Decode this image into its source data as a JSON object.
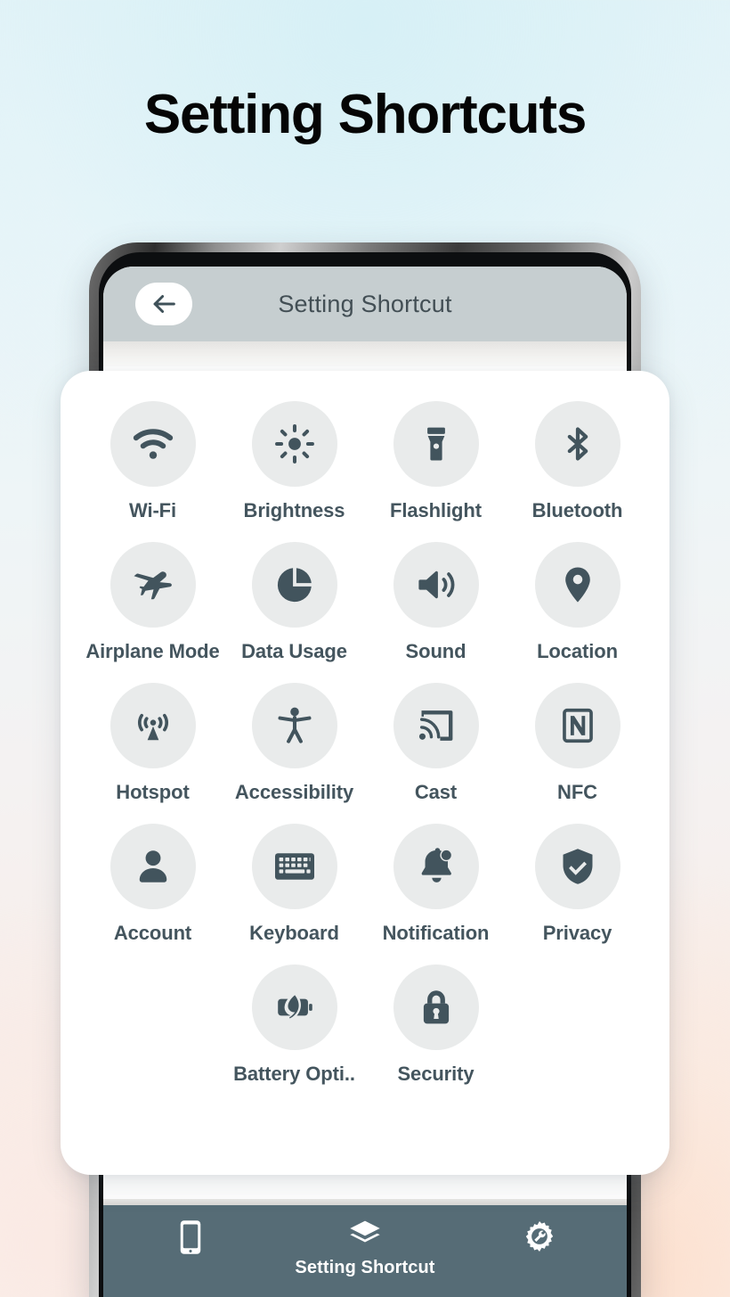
{
  "page": {
    "title": "Setting Shortcuts"
  },
  "colors": {
    "icon_dark": "#42545d",
    "tile_circle": "#e9ebeb",
    "header_bar": "#c6ced0",
    "bottom_nav": "#566c76",
    "label_text": "#44555e"
  },
  "app_header": {
    "back_icon": "arrow-left-icon",
    "title": "Setting Shortcut"
  },
  "shortcuts": [
    {
      "label": "Wi-Fi",
      "icon": "wifi-icon"
    },
    {
      "label": "Brightness",
      "icon": "brightness-sun-icon"
    },
    {
      "label": "Flashlight",
      "icon": "flashlight-icon"
    },
    {
      "label": "Bluetooth",
      "icon": "bluetooth-icon"
    },
    {
      "label": "Airplane Mode",
      "icon": "airplane-icon"
    },
    {
      "label": "Data Usage",
      "icon": "pie-chart-icon"
    },
    {
      "label": "Sound",
      "icon": "speaker-volume-icon"
    },
    {
      "label": "Location",
      "icon": "map-pin-icon"
    },
    {
      "label": "Hotspot",
      "icon": "hotspot-broadcast-icon"
    },
    {
      "label": "Accessibility",
      "icon": "accessibility-person-icon"
    },
    {
      "label": "Cast",
      "icon": "cast-screen-icon"
    },
    {
      "label": "NFC",
      "icon": "nfc-icon"
    },
    {
      "label": "Account",
      "icon": "person-account-icon"
    },
    {
      "label": "Keyboard",
      "icon": "keyboard-icon"
    },
    {
      "label": "Notification",
      "icon": "bell-notification-icon"
    },
    {
      "label": "Privacy",
      "icon": "shield-check-icon"
    },
    {
      "label": "Battery Opti..",
      "icon": "battery-leaf-icon"
    },
    {
      "label": "Security",
      "icon": "lock-icon"
    }
  ],
  "bottom_nav": {
    "items": [
      {
        "label": "",
        "icon": "mobile-phone-icon"
      },
      {
        "label": "Setting Shortcut",
        "icon": "layers-stack-icon"
      },
      {
        "label": "",
        "icon": "gear-wrench-icon"
      }
    ]
  }
}
